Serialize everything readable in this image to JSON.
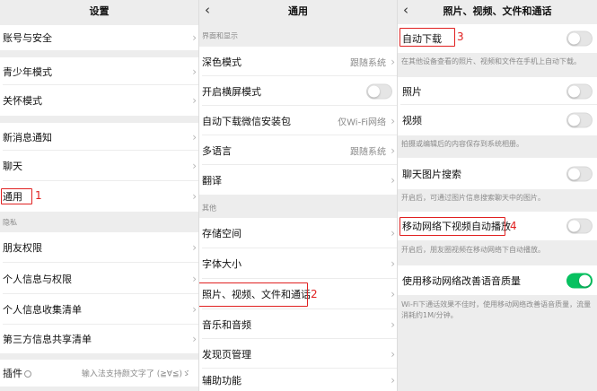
{
  "colors": {
    "annotation": "#e02020",
    "toggle_on": "#07c160",
    "toggle_off": "#e5e5e5"
  },
  "icons": {
    "back": "chevron-left-icon",
    "chevron": "chevron-right-icon",
    "plugin": "plugin-icon"
  },
  "panel1": {
    "title": "设置",
    "items": [
      {
        "label": "账号与安全"
      },
      {
        "label": "青少年模式"
      },
      {
        "label": "关怀模式"
      },
      {
        "label": "新消息通知"
      },
      {
        "label": "聊天"
      },
      {
        "label": "通用"
      },
      {
        "label": "朋友权限"
      },
      {
        "label": "个人信息与权限"
      },
      {
        "label": "个人信息收集清单"
      },
      {
        "label": "第三方信息共享清单"
      },
      {
        "label": "插件",
        "value": "输入法支持颜文字了 (≧∀≦)ゞ"
      }
    ],
    "section_privacy": "隐私",
    "annotation": "1"
  },
  "panel2": {
    "title": "通用",
    "section_display": "界面和显示",
    "section_other": "其他",
    "items": [
      {
        "label": "深色模式",
        "value": "跟随系统"
      },
      {
        "label": "开启横屏模式",
        "toggle": false
      },
      {
        "label": "自动下载微信安装包",
        "value": "仅Wi-Fi网络"
      },
      {
        "label": "多语言",
        "value": "跟随系统"
      },
      {
        "label": "翻译"
      },
      {
        "label": "存储空间"
      },
      {
        "label": "字体大小"
      },
      {
        "label": "照片、视频、文件和通话"
      },
      {
        "label": "音乐和音频"
      },
      {
        "label": "发现页管理"
      },
      {
        "label": "辅助功能"
      }
    ],
    "annotation": "2"
  },
  "panel3": {
    "title": "照片、视频、文件和通话",
    "items": [
      {
        "label": "自动下载",
        "toggle": false
      },
      {
        "label": "照片",
        "toggle": false
      },
      {
        "label": "视频",
        "toggle": false
      },
      {
        "label": "聊天图片搜索",
        "toggle": false
      },
      {
        "label": "移动网络下视频自动播放",
        "toggle": false
      },
      {
        "label": "使用移动网络改善语音质量",
        "toggle": true
      }
    ],
    "hints": [
      "在其他设备查看的照片、视频和文件在手机上自动下载。",
      "拍摄或编辑后的内容保存到系统相册。",
      "开启后，可通过图片信息搜索聊天中的图片。",
      "开启后，朋友圈视频在移动网络下自动播放。",
      "Wi-Fi下通话效果不佳时，使用移动网络改善语音质量，流量消耗约1M/分钟。"
    ],
    "annotations": [
      "3",
      "4"
    ]
  }
}
